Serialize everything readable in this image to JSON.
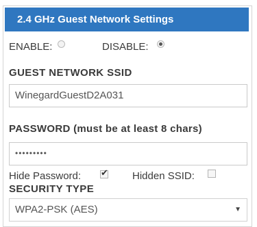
{
  "panel": {
    "header_title": "2.4 GHz Guest Network Settings"
  },
  "enable_disable": {
    "enable_label": "ENABLE:",
    "disable_label": "DISABLE:",
    "selected": "disable"
  },
  "ssid": {
    "section_label": "GUEST NETWORK SSID",
    "value": "WinegardGuestD2A031"
  },
  "password": {
    "section_label": "PASSWORD (must be at least 8 chars)",
    "value": "•••••••••"
  },
  "options": {
    "hide_password_label": "Hide Password:",
    "hide_password_checked": true,
    "hidden_ssid_label": "Hidden SSID:",
    "hidden_ssid_checked": false
  },
  "security": {
    "section_label": "SECURITY TYPE",
    "selected_value": "WPA2-PSK (AES)"
  },
  "icons": {
    "checkmark": "✔",
    "dropdown_arrow": "▼"
  },
  "colors": {
    "header_bg": "#2f77c0",
    "header_text": "#ffffff"
  }
}
